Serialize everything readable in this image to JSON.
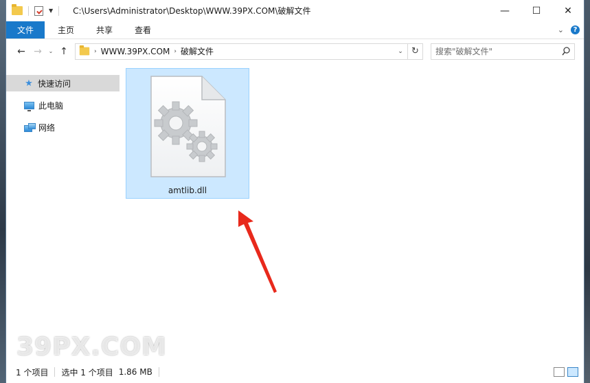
{
  "window": {
    "title_path": "C:\\Users\\Administrator\\Desktop\\WWW.39PX.COM\\破解文件",
    "minimize": "—",
    "maximize": "☐",
    "close": "✕"
  },
  "ribbon": {
    "tabs": [
      {
        "label": "文件",
        "active": true
      },
      {
        "label": "主页"
      },
      {
        "label": "共享"
      },
      {
        "label": "查看"
      }
    ]
  },
  "address": {
    "crumbs": [
      "WWW.39PX.COM",
      "破解文件"
    ]
  },
  "search": {
    "placeholder": "搜索\"破解文件\""
  },
  "nav_pane": {
    "items": [
      {
        "label": "快速访问",
        "icon": "star-icon",
        "selected": true
      },
      {
        "label": "此电脑",
        "icon": "pc-icon"
      },
      {
        "label": "网络",
        "icon": "network-icon"
      }
    ]
  },
  "files": [
    {
      "name": "amtlib.dll",
      "icon": "dll-file-icon",
      "selected": true
    }
  ],
  "status": {
    "item_count": "1 个项目",
    "selected_count": "选中 1 个项目",
    "size": "1.86 MB"
  },
  "watermark": "39PX.COM",
  "colors": {
    "accent": "#1979ca",
    "selection_fill": "#cce8ff",
    "selection_border": "#99d1ff",
    "arrow": "#e8291c"
  }
}
